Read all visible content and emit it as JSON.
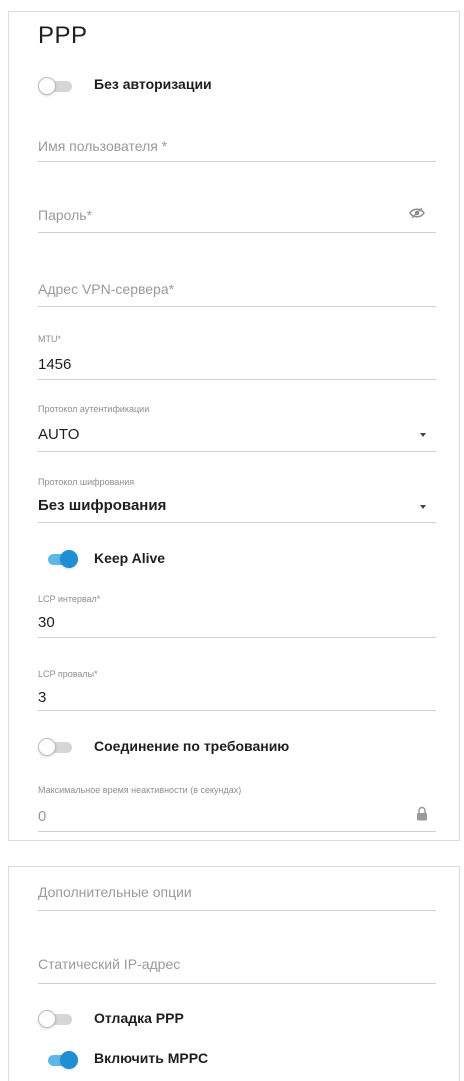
{
  "section": {
    "title": "PPP"
  },
  "toggles": {
    "no_auth": {
      "label": "Без авторизации",
      "on": false
    },
    "keep_alive": {
      "label": "Keep Alive",
      "on": true
    },
    "on_demand": {
      "label": "Соединение по требованию",
      "on": false
    },
    "ppp_debug": {
      "label": "Отладка PPP",
      "on": false
    },
    "mppc": {
      "label": "Включить MPPC",
      "on": true
    }
  },
  "fields": {
    "username": {
      "placeholder": "Имя пользователя *"
    },
    "password": {
      "placeholder": "Пароль*",
      "icon": "eye-icon"
    },
    "vpn_server": {
      "placeholder": "Адрес VPN-сервера*"
    },
    "mtu": {
      "label": "MTU*",
      "value": "1456"
    },
    "auth_protocol": {
      "label": "Протокол аутентификации",
      "value": "AUTO",
      "icon": "chevron-down-icon"
    },
    "encryption_protocol": {
      "label": "Протокол шифрования",
      "value": "Без шифрования",
      "icon": "chevron-down-icon"
    },
    "lcp_interval": {
      "label": "LCP интервал*",
      "value": "30"
    },
    "lcp_fails": {
      "label": "LCP провалы*",
      "value": "3"
    },
    "idle_time": {
      "label": "Максимальное время неактивности (в секундах)",
      "value": "0",
      "icon": "lock-icon"
    },
    "extra_options": {
      "placeholder": "Дополнительные опции"
    },
    "static_ip": {
      "placeholder": "Статический IP-адрес"
    }
  },
  "colors": {
    "accent": "#1f8fd3",
    "accent_track": "#5fb7e8"
  }
}
